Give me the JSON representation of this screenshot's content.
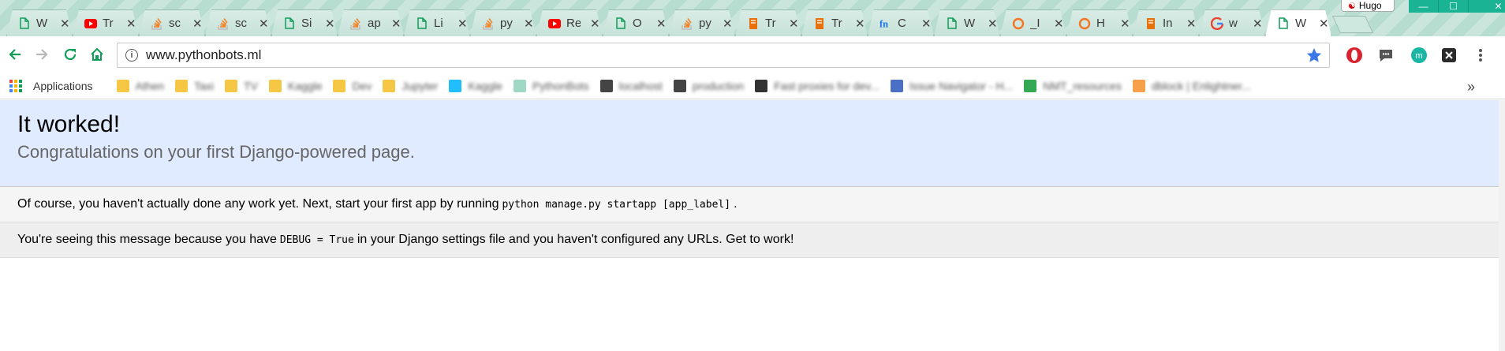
{
  "browser": {
    "tabs": [
      {
        "title": "W",
        "icon": "page-icon",
        "color": "#0f9d58"
      },
      {
        "title": "Tr",
        "icon": "youtube-icon",
        "color": "#ff0000"
      },
      {
        "title": "sc",
        "icon": "stackoverflow-icon",
        "color": "#f48024"
      },
      {
        "title": "sc",
        "icon": "stackoverflow-icon",
        "color": "#f48024"
      },
      {
        "title": "Si",
        "icon": "page-icon",
        "color": "#0f9d58"
      },
      {
        "title": "ap",
        "icon": "stackoverflow-icon",
        "color": "#f48024"
      },
      {
        "title": "Li",
        "icon": "page-icon",
        "color": "#0f9d58"
      },
      {
        "title": "py",
        "icon": "stackoverflow-icon",
        "color": "#f48024"
      },
      {
        "title": "Re",
        "icon": "youtube-icon",
        "color": "#ff0000"
      },
      {
        "title": "O",
        "icon": "page-icon",
        "color": "#0f9d58"
      },
      {
        "title": "py",
        "icon": "stackoverflow-icon",
        "color": "#f48024"
      },
      {
        "title": "Tr",
        "icon": "book-icon",
        "color": "#e8710a"
      },
      {
        "title": "Tr",
        "icon": "book-icon",
        "color": "#e8710a"
      },
      {
        "title": "C",
        "icon": "fn-icon",
        "color": "#1a73e8"
      },
      {
        "title": "W",
        "icon": "page-icon",
        "color": "#0f9d58"
      },
      {
        "title": "_I",
        "icon": "ring-icon",
        "color": "#f37626"
      },
      {
        "title": "H",
        "icon": "ring-icon",
        "color": "#f37626"
      },
      {
        "title": "In",
        "icon": "book-icon",
        "color": "#e8710a"
      },
      {
        "title": "w",
        "icon": "google-icon",
        "color": "#4285f4"
      },
      {
        "title": "W",
        "icon": "page-icon",
        "color": "#0f9d58",
        "active": true
      }
    ],
    "profile_name": "Hugo",
    "url": "www.pythonbots.ml"
  },
  "bookmarks": {
    "apps_label": "Applications",
    "items": [
      {
        "label": "Athen",
        "color": "#f6c744"
      },
      {
        "label": "Taxi",
        "color": "#f6c744"
      },
      {
        "label": "TV",
        "color": "#f6c744"
      },
      {
        "label": "Kaggle",
        "color": "#f6c744"
      },
      {
        "label": "Dev",
        "color": "#f6c744"
      },
      {
        "label": "Jupyter",
        "color": "#f6c744"
      },
      {
        "label": "Kaggle",
        "color": "#20beff"
      },
      {
        "label": "PythonBots",
        "color": "#9fd9c6"
      },
      {
        "label": "localhost",
        "color": "#444444"
      },
      {
        "label": "production",
        "color": "#444444"
      },
      {
        "label": "Fast proxies for dev...",
        "color": "#333333"
      },
      {
        "label": "Issue Navigator - H...",
        "color": "#4a6fc4"
      },
      {
        "label": "NMT_resources",
        "color": "#34a853"
      },
      {
        "label": "dblock | Enlightner...",
        "color": "#f7a04b"
      }
    ]
  },
  "page": {
    "title": "It worked!",
    "subtitle": "Congratulations on your first Django-powered page.",
    "instructions_before": "Of course, you haven't actually done any work yet. Next, start your first app by running",
    "instructions_code": "python manage.py startapp [app_label]",
    "instructions_after": ".",
    "explanation_before": "You're seeing this message because you have",
    "explanation_code": "DEBUG = True",
    "explanation_after": "in your Django settings file and you haven't configured any URLs. Get to work!"
  }
}
